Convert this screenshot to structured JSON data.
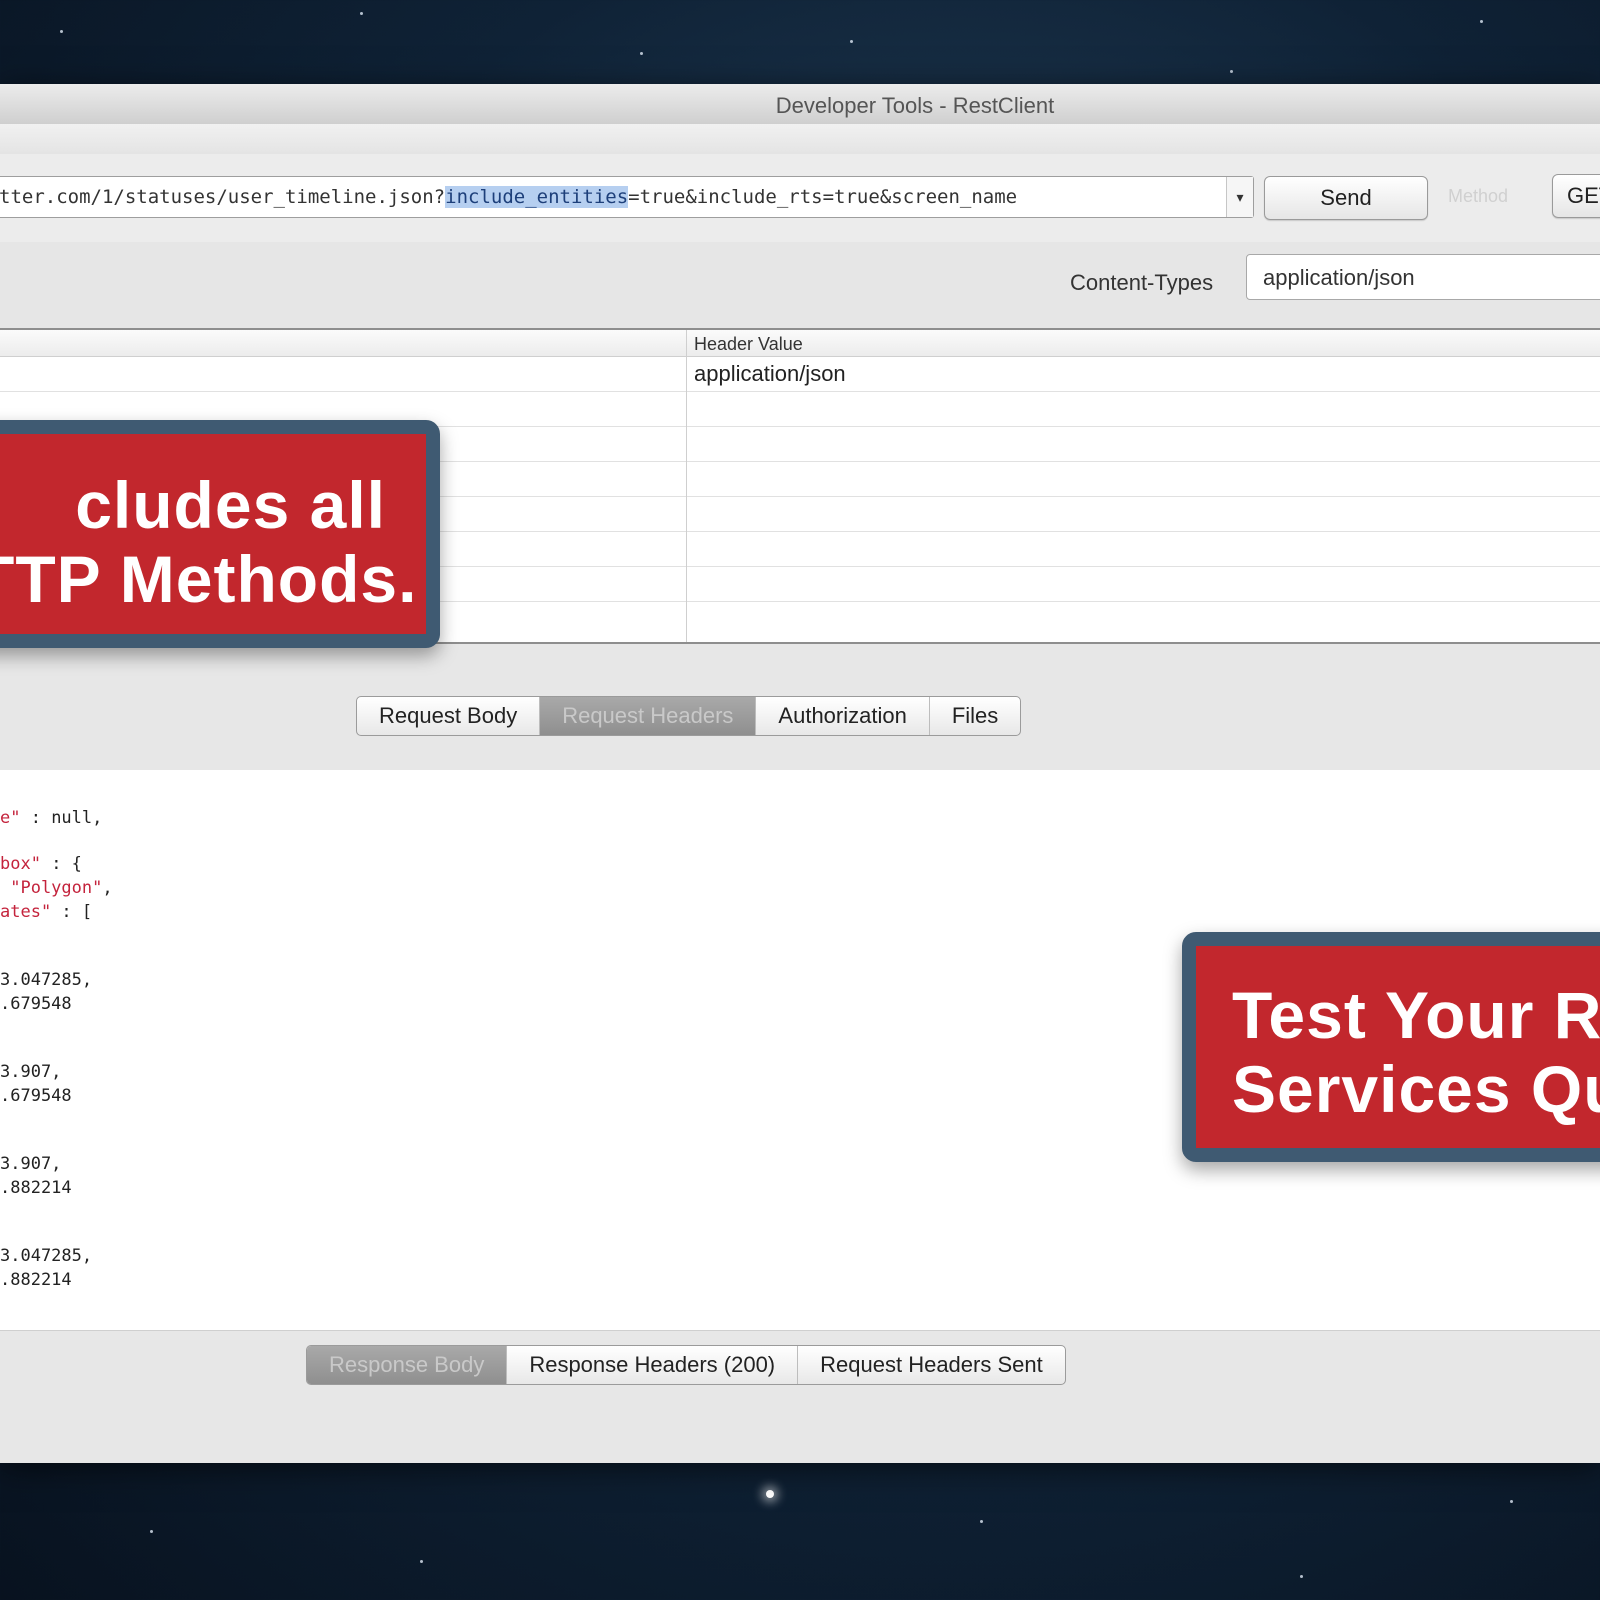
{
  "window": {
    "title": "Developer Tools - RestClient"
  },
  "request": {
    "url_prefix": "tter.com/1/statuses/user_timeline.json?",
    "url_highlight": "include_entities",
    "url_suffix": "=true&include_rts=true&screen_name",
    "dropdown_icon": "▾",
    "send_label": "Send",
    "method_label": "Method",
    "method_value": "GET",
    "content_type_label": "Content-Types",
    "content_type_value": "application/json"
  },
  "headers_grid": {
    "column_value_header": "Header Value",
    "rows": [
      {
        "value": "application/json"
      },
      {
        "value": ""
      },
      {
        "value": ""
      },
      {
        "value": ""
      },
      {
        "value": ""
      },
      {
        "value": ""
      },
      {
        "value": ""
      }
    ]
  },
  "request_tabs": [
    {
      "label": "Request Body",
      "active": false
    },
    {
      "label": "Request Headers",
      "active": true
    },
    {
      "label": "Authorization",
      "active": false
    },
    {
      "label": "Files",
      "active": false
    }
  ],
  "response_json_lines": [
    {
      "key": "e\"",
      "rest": " : null,"
    },
    {
      "key": "box\"",
      "rest": " : {"
    },
    {
      "key": " \"Polygon\"",
      "rest": ","
    },
    {
      "key": "ates\"",
      "rest": " : ["
    },
    {
      "key": "",
      "rest": "3.047285,"
    },
    {
      "key": "",
      "rest": ".679548"
    },
    {
      "key": "",
      "rest": "3.907,"
    },
    {
      "key": "",
      "rest": ".679548"
    },
    {
      "key": "",
      "rest": "3.907,"
    },
    {
      "key": "",
      "rest": ".882214"
    },
    {
      "key": "",
      "rest": "3.047285,"
    },
    {
      "key": "",
      "rest": ".882214"
    }
  ],
  "response_tabs": [
    {
      "label": "Response Body",
      "active": true
    },
    {
      "label": "Response Headers (200)",
      "active": false
    },
    {
      "label": "Request Headers Sent",
      "active": false
    }
  ],
  "callouts": {
    "first": {
      "line1": "cludes all",
      "line2": "TTP Methods."
    },
    "second": {
      "line1": "Test Your R",
      "line2": "Services Qu"
    }
  },
  "colors": {
    "callout_red": "#c2272d",
    "callout_border": "#3f5a72",
    "highlight": "#b6cff0"
  }
}
